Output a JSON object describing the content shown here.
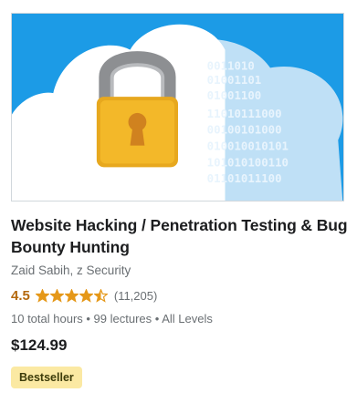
{
  "course": {
    "thumbnail_icon": "cloud-padlock-binary-icon",
    "binary_lines": [
      "0011010",
      "01001101",
      "01001100",
      "11010111000",
      "00100101000",
      "010010010101",
      "101010100110",
      "01101011100"
    ],
    "title": "Website Hacking / Penetration Testing & Bug Bounty Hunting",
    "instructors": "Zaid Sabih, z Security",
    "rating": "4.5",
    "rating_value": 4.5,
    "rating_count": "(11,205)",
    "meta": "10 total hours • 99 lectures • All Levels",
    "price": "$124.99",
    "badge": "Bestseller"
  },
  "colors": {
    "rating": "#b4690e",
    "star": "#e59819",
    "badge_bg": "#fbe9a3",
    "thumb_bg": "#1c9be6"
  }
}
